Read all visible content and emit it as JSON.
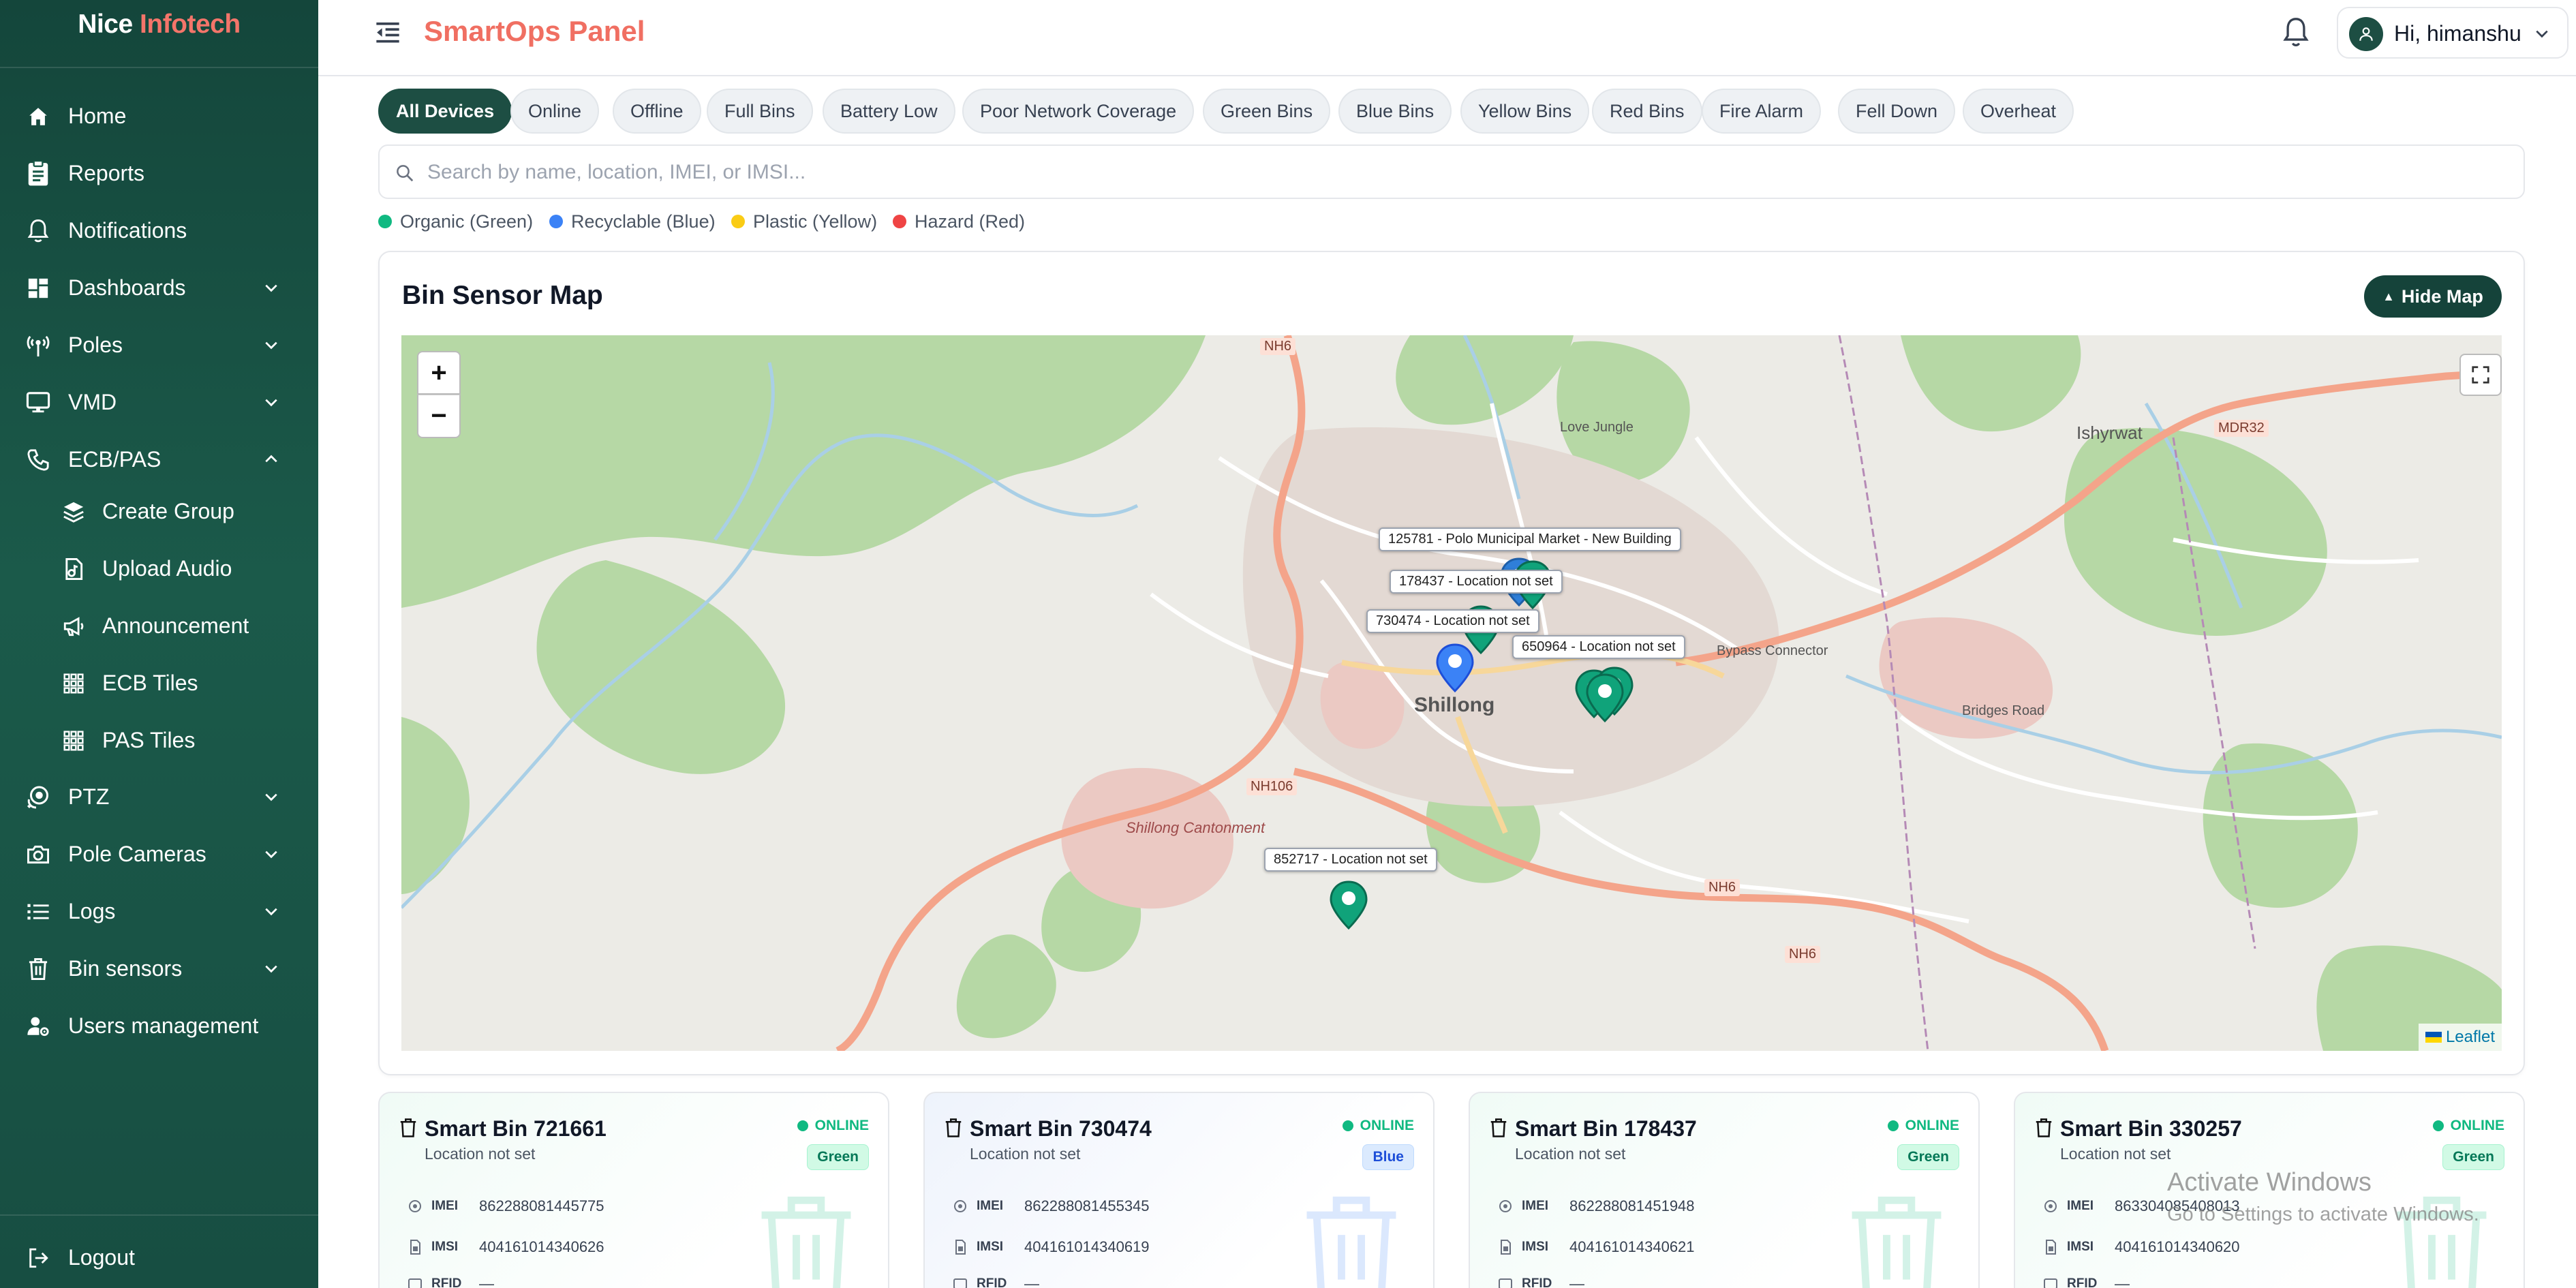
{
  "brand": {
    "part1": "Nice",
    "part2": "Infotech"
  },
  "sidebar": {
    "items": [
      {
        "label": "Home",
        "icon": "home-icon"
      },
      {
        "label": "Reports",
        "icon": "report-icon"
      },
      {
        "label": "Notifications",
        "icon": "bell-icon"
      },
      {
        "label": "Dashboards",
        "icon": "dashboard-icon",
        "expandable": true
      },
      {
        "label": "Poles",
        "icon": "antenna-icon",
        "expandable": true
      },
      {
        "label": "VMD",
        "icon": "monitor-icon",
        "expandable": true
      },
      {
        "label": "ECB/PAS",
        "icon": "phone-icon",
        "expanded": true
      }
    ],
    "sub_items": [
      {
        "label": "Create Group",
        "icon": "layers-icon"
      },
      {
        "label": "Upload Audio",
        "icon": "audio-file-icon"
      },
      {
        "label": "Announcement",
        "icon": "megaphone-icon"
      },
      {
        "label": "ECB Tiles",
        "icon": "grid-icon"
      },
      {
        "label": "PAS Tiles",
        "icon": "grid-icon"
      }
    ],
    "items_after": [
      {
        "label": "PTZ",
        "icon": "ptz-camera-icon",
        "expandable": true
      },
      {
        "label": "Pole Cameras",
        "icon": "camera-icon",
        "expandable": true
      },
      {
        "label": "Logs",
        "icon": "list-icon",
        "expandable": true
      },
      {
        "label": "Bin sensors",
        "icon": "trash-icon",
        "expandable": true
      },
      {
        "label": "Users management",
        "icon": "users-cog-icon"
      }
    ],
    "logout": "Logout"
  },
  "header": {
    "title": "SmartOps Panel",
    "greeting": "Hi, himanshu"
  },
  "filters": [
    "All Devices",
    "Online",
    "Offline",
    "Full Bins",
    "Battery Low",
    "Poor Network Coverage",
    "Green Bins",
    "Blue Bins",
    "Yellow Bins",
    "Red Bins",
    "Fire Alarm",
    "Fell Down",
    "Overheat"
  ],
  "active_filter": "All Devices",
  "search": {
    "placeholder": "Search by name, location, IMEI, or IMSI...",
    "value": ""
  },
  "legend": [
    {
      "label": "Organic (Green)",
      "color": "#10b981"
    },
    {
      "label": "Recyclable (Blue)",
      "color": "#3b82f6"
    },
    {
      "label": "Plastic (Yellow)",
      "color": "#facc15"
    },
    {
      "label": "Hazard (Red)",
      "color": "#ef4444"
    }
  ],
  "map_section": {
    "title": "Bin Sensor Map",
    "hide_button": "Hide Map",
    "attribution": "Leaflet",
    "zoom_in": "+",
    "zoom_out": "−"
  },
  "map_labels": {
    "city": "Shillong",
    "cantonment": "Shillong Cantonment",
    "roads": [
      "NH6",
      "NH106",
      "NH6",
      "NH6",
      "MDR32"
    ],
    "places": [
      "Ishyrwat",
      "Love Jungle",
      "Bypass Connector",
      "Bridges Road"
    ]
  },
  "map_tooltips": [
    "125781 - Polo Municipal Market - New Building",
    "178437 - Location not set",
    "730474 - Location not set",
    "650964 - Location not set",
    "852717 - Location not set"
  ],
  "map_markers": [
    {
      "id": "125781",
      "color": "#2f7fd9"
    },
    {
      "id": "178437",
      "color": "#10a37a"
    },
    {
      "id": "730474",
      "color": "#3b82f6"
    },
    {
      "id": "650964",
      "color": "#10a37a"
    },
    {
      "id": "852717",
      "color": "#10a37a"
    }
  ],
  "bins": [
    {
      "title": "Smart Bin 721661",
      "location": "Location not set",
      "status": "ONLINE",
      "type": "Green",
      "imei_label": "IMEI",
      "imei": "862288081445775",
      "imsi_label": "IMSI",
      "imsi": "404161014340626",
      "rfid_label": "RFID",
      "rfid": "—"
    },
    {
      "title": "Smart Bin 730474",
      "location": "Location not set",
      "status": "ONLINE",
      "type": "Blue",
      "imei_label": "IMEI",
      "imei": "862288081455345",
      "imsi_label": "IMSI",
      "imsi": "404161014340619",
      "rfid_label": "RFID",
      "rfid": "—"
    },
    {
      "title": "Smart Bin 178437",
      "location": "Location not set",
      "status": "ONLINE",
      "type": "Green",
      "imei_label": "IMEI",
      "imei": "862288081451948",
      "imsi_label": "IMSI",
      "imsi": "404161014340621",
      "rfid_label": "RFID",
      "rfid": "—"
    },
    {
      "title": "Smart Bin 330257",
      "location": "Location not set",
      "status": "ONLINE",
      "type": "Green",
      "imei_label": "IMEI",
      "imei": "863304085408013",
      "imsi_label": "IMSI",
      "imsi": "404161014340620",
      "rfid_label": "RFID",
      "rfid": "—"
    }
  ],
  "os_overlay": {
    "line1": "Activate Windows",
    "line2": "Go to Settings to activate Windows."
  }
}
